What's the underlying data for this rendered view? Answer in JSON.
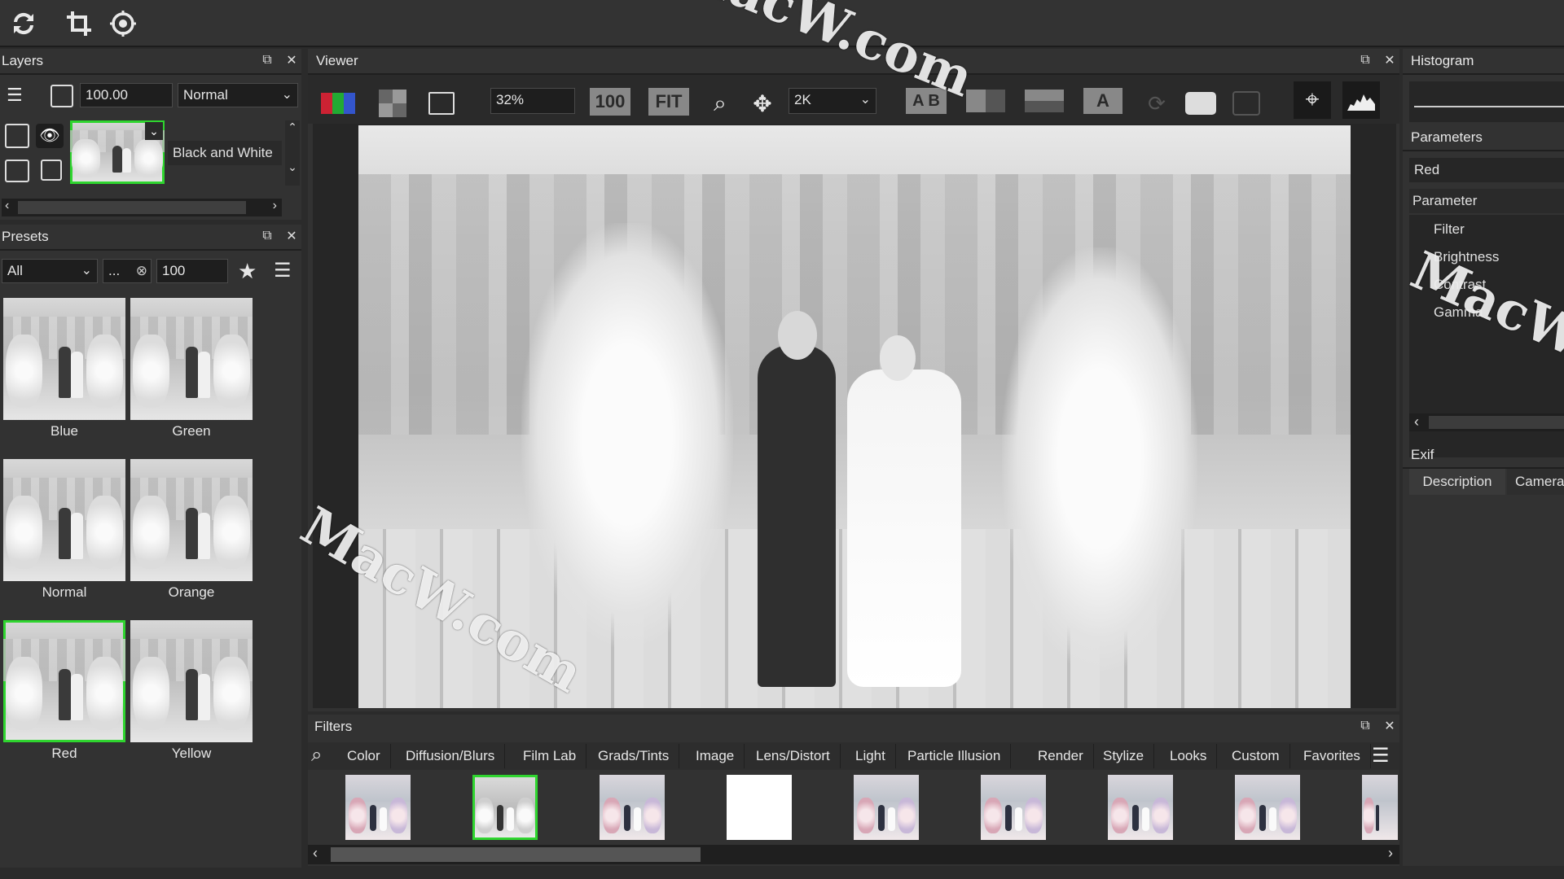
{
  "toolbar": {
    "icons": [
      "refresh-icon",
      "crop-icon",
      "target-icon"
    ]
  },
  "layers": {
    "title": "Layers",
    "opacity": "100.00",
    "blend_mode": "Normal",
    "layer_name": "Black and White"
  },
  "presets": {
    "title": "Presets",
    "category": "All",
    "search": "...",
    "size": "100",
    "items": [
      "Blue",
      "Green",
      "Normal",
      "Orange",
      "Red",
      "Yellow"
    ],
    "selected": "Red"
  },
  "viewer": {
    "title": "Viewer",
    "zoom": "32%",
    "zoom_100": "100",
    "fit": "FIT",
    "resolution": "2K",
    "ab": "A B"
  },
  "filters": {
    "title": "Filters",
    "tabs": [
      "Color",
      "Diffusion/Blurs",
      "Film Lab",
      "Grads/Tints",
      "Image",
      "Lens/Distort",
      "Light",
      "Particle Illusion",
      "Render",
      "Stylize",
      "Looks",
      "Custom",
      "Favorites"
    ]
  },
  "histogram": {
    "title": "Histogram"
  },
  "parameters": {
    "title": "Parameters",
    "preset_value": "Red",
    "header": "Parameter",
    "items": [
      "Filter",
      "Brightness",
      "Contrast",
      "Gamma"
    ]
  },
  "exif": {
    "title": "Exif",
    "tabs": [
      "Description",
      "Camera"
    ]
  },
  "watermark": {
    "text": "MacW.com"
  },
  "colors": {
    "selection": "#2fd52f",
    "panel": "#323232",
    "background": "#2b2b2b"
  }
}
